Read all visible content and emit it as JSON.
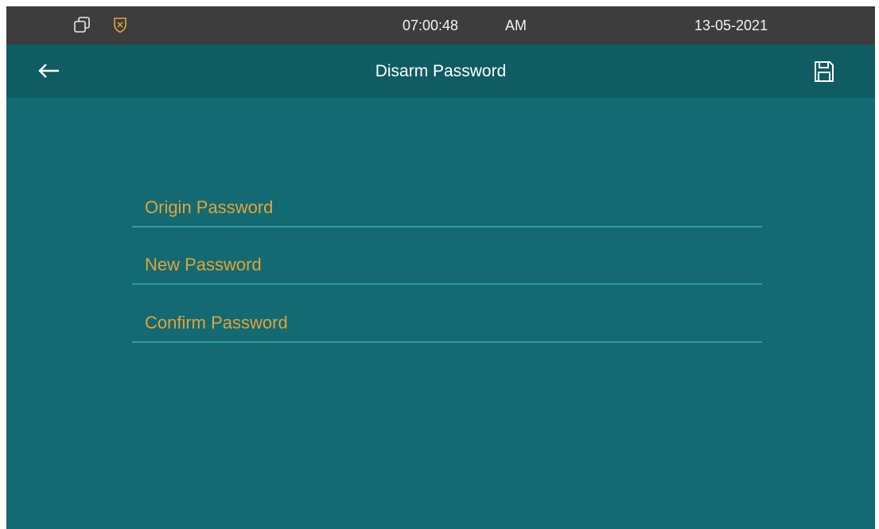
{
  "status_bar": {
    "time": "07:00:48",
    "ampm": "AM",
    "date": "13-05-2021",
    "icons": [
      "multi-window-icon",
      "shield-alarm-icon"
    ]
  },
  "header": {
    "title": "Disarm Password",
    "back_icon": "back-arrow-icon",
    "save_icon": "save-icon"
  },
  "form": {
    "fields": [
      {
        "label": "Origin Password",
        "value": ""
      },
      {
        "label": "New Password",
        "value": ""
      },
      {
        "label": "Confirm Password",
        "value": ""
      }
    ]
  },
  "colors": {
    "status_bar_bg": "#3d3d3d",
    "header_bg": "#0f5c63",
    "screen_bg": "#136a72",
    "label_color": "#e2a33a",
    "field_underline": "#2f9aa4",
    "shield_icon": "#e2a33a"
  }
}
